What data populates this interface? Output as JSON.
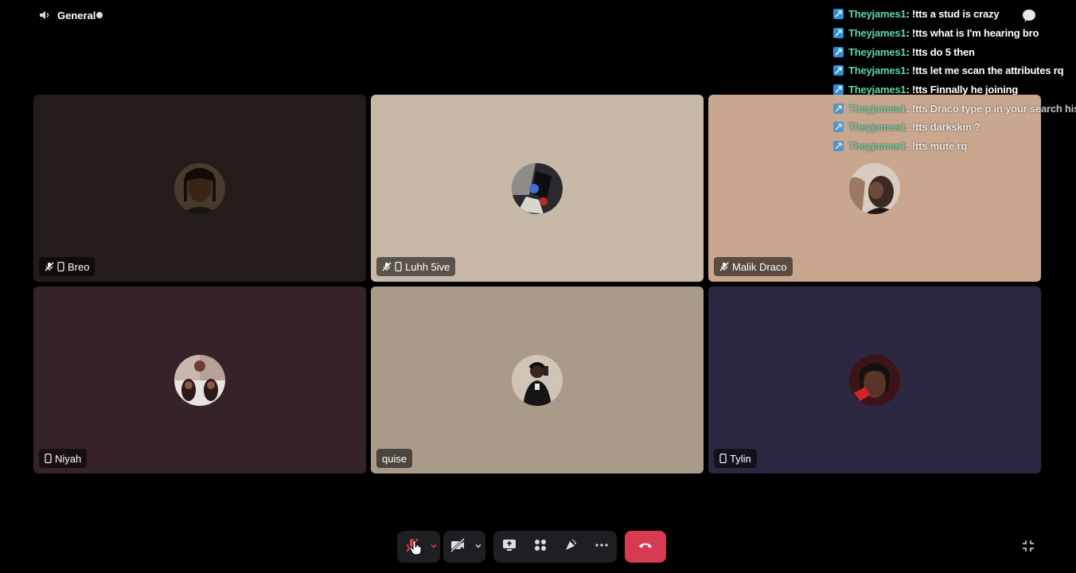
{
  "channel": {
    "name": "General",
    "icon": "speaker-icon"
  },
  "participants": [
    {
      "name": "Breo",
      "bg": "#241c18",
      "muted": true,
      "mobile": true
    },
    {
      "name": "Luhh 5ive",
      "bg": "#c8b8a8",
      "muted": true,
      "mobile": true
    },
    {
      "name": "Malik Draco",
      "bg": "#c9a78f",
      "muted": true,
      "mobile": false
    },
    {
      "name": "Niyah",
      "bg": "#362328",
      "muted": false,
      "mobile": true
    },
    {
      "name": "quise",
      "bg": "#a99a8a",
      "muted": false,
      "mobile": false
    },
    {
      "name": "Tylin",
      "bg": "#2d2641",
      "muted": false,
      "mobile": true
    }
  ],
  "chat": [
    {
      "user": "Theyjames1",
      "message": " : !tts a stud is crazy"
    },
    {
      "user": "Theyjames1",
      "message": " : !tts what is I'm hearing bro"
    },
    {
      "user": "Theyjames1",
      "message": " : !tts do 5 then"
    },
    {
      "user": "Theyjames1",
      "message": " : !tts let me scan the attributes rq"
    },
    {
      "user": "Theyjames1",
      "message": " : !tts Finnally he joining"
    },
    {
      "user": "Theyjames1",
      "message": " : !tts Draco type p in your search history"
    },
    {
      "user": "Theyjames1",
      "message": " : !tts darkskin ?"
    },
    {
      "user": "Theyjames1",
      "message": " : !tts mute rq"
    }
  ],
  "controls": {
    "microphone": "microphone-muted-icon",
    "camera": "camera-off-icon",
    "screen_share": "screen-share-icon",
    "activities": "activities-icon",
    "soundboard": "soundboard-icon",
    "more": "more-icon",
    "hangup": "hang-up-icon",
    "minimize": "minimize-icon"
  },
  "colors": {
    "hangup": "#d83a52",
    "chat_user": "#5fd6a8",
    "badge": "#2f8fd6",
    "control_bar": "#1e1f22"
  }
}
